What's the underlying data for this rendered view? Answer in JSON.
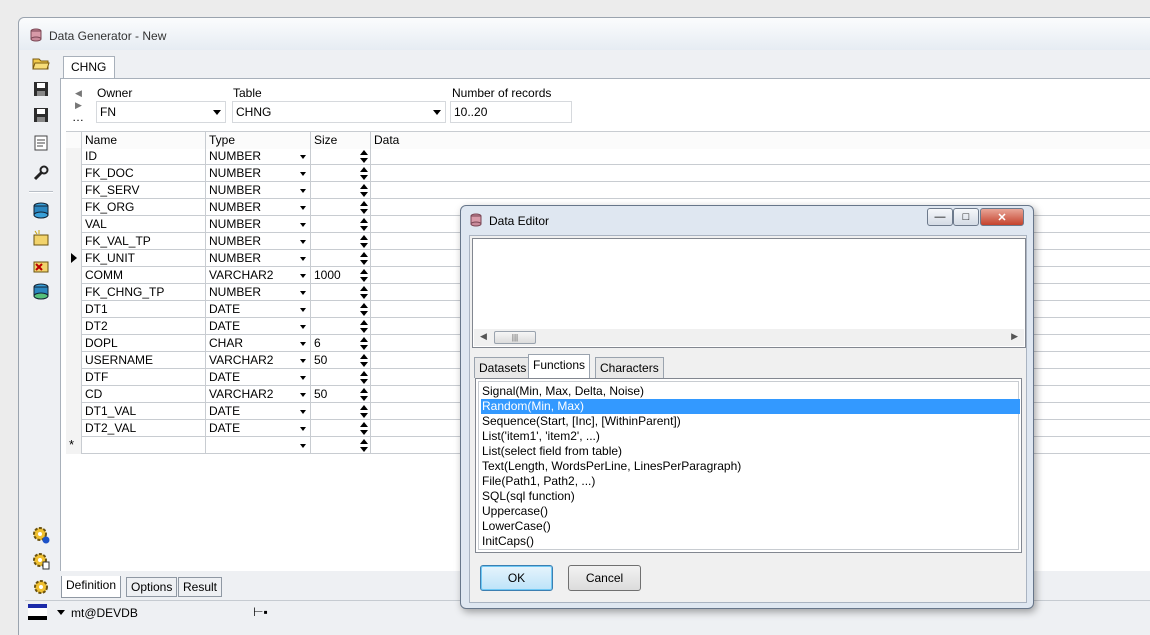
{
  "window": {
    "title": "Data Generator - New"
  },
  "doc_tab": "CHNG",
  "header": {
    "owner_label": "Owner",
    "owner_value": "FN",
    "table_label": "Table",
    "table_value": "CHNG",
    "records_label": "Number of records",
    "records_value": "10..20"
  },
  "grid": {
    "columns": [
      "Name",
      "Type",
      "Size",
      "Data"
    ],
    "rows": [
      {
        "name": "ID",
        "type": "NUMBER",
        "size": ""
      },
      {
        "name": "FK_DOC",
        "type": "NUMBER",
        "size": ""
      },
      {
        "name": "FK_SERV",
        "type": "NUMBER",
        "size": ""
      },
      {
        "name": "FK_ORG",
        "type": "NUMBER",
        "size": ""
      },
      {
        "name": "VAL",
        "type": "NUMBER",
        "size": ""
      },
      {
        "name": "FK_VAL_TP",
        "type": "NUMBER",
        "size": ""
      },
      {
        "name": "FK_UNIT",
        "type": "NUMBER",
        "size": ""
      },
      {
        "name": "COMM",
        "type": "VARCHAR2",
        "size": "1000"
      },
      {
        "name": "FK_CHNG_TP",
        "type": "NUMBER",
        "size": ""
      },
      {
        "name": "DT1",
        "type": "DATE",
        "size": ""
      },
      {
        "name": "DT2",
        "type": "DATE",
        "size": ""
      },
      {
        "name": "DOPL",
        "type": "CHAR",
        "size": "6"
      },
      {
        "name": "USERNAME",
        "type": "VARCHAR2",
        "size": "50"
      },
      {
        "name": "DTF",
        "type": "DATE",
        "size": ""
      },
      {
        "name": "CD",
        "type": "VARCHAR2",
        "size": "50"
      },
      {
        "name": "DT1_VAL",
        "type": "DATE",
        "size": ""
      },
      {
        "name": "DT2_VAL",
        "type": "DATE",
        "size": ""
      }
    ],
    "current_row_index": 6,
    "new_row_marker": "*"
  },
  "bottom_tabs": [
    "Definition",
    "Options",
    "Result"
  ],
  "status": {
    "connection": "mt@DEVDB"
  },
  "dialog": {
    "title": "Data Editor",
    "tabs": [
      "Datasets",
      "Functions",
      "Characters"
    ],
    "active_tab": "Functions",
    "functions": [
      "Signal(Min, Max, Delta, Noise)",
      "Random(Min, Max)",
      "Sequence(Start, [Inc], [WithinParent])",
      "List('item1', 'item2', ...)",
      "List(select field from table)",
      "Text(Length, WordsPerLine, LinesPerParagraph)",
      "File(Path1, Path2, ...)",
      "SQL(sql function)",
      "Uppercase()",
      "LowerCase()",
      "InitCaps()"
    ],
    "selected_function": "Random(Min, Max)",
    "ok_label": "OK",
    "cancel_label": "Cancel"
  },
  "icons": [
    "app-db-icon",
    "open-folder-icon",
    "save-icon",
    "save-as-icon",
    "properties-icon",
    "wrench-icon",
    "db-icon",
    "table-add-icon",
    "table-delete-icon",
    "db-green-icon",
    "gear-info-icon",
    "gear-doc-icon",
    "gear-icon",
    "pin-icon"
  ],
  "colors": {
    "selection": "#3399ff",
    "title_bar": "#e6ecf3"
  }
}
